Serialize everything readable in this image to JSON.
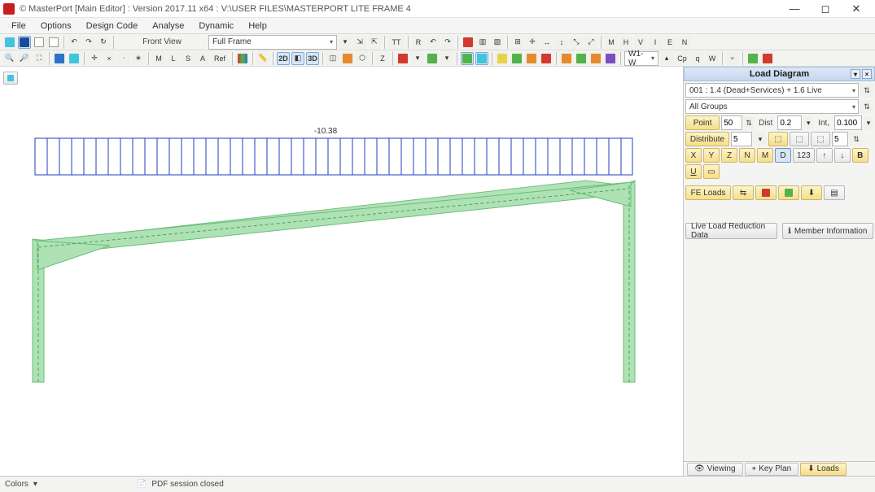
{
  "title": "© MasterPort [Main Editor] : Version 2017.11 x64 : V:\\USER FILES\\MASTERPORT LITE  FRAME 4",
  "menu": [
    "File",
    "Options",
    "Design Code",
    "Analyse",
    "Dynamic",
    "Help"
  ],
  "toolbar1": {
    "view_label": "Front View",
    "frame_select": "Full Frame",
    "letters": [
      "TT",
      "R",
      "S",
      "H",
      "V",
      "I",
      "E",
      "N"
    ],
    "middle_letters": [
      "M",
      "H",
      "V",
      "I",
      "E",
      "N"
    ],
    "r_label": "R"
  },
  "toolbar2": {
    "letters_group1": [
      "M",
      "L",
      "S",
      "A",
      "Ref"
    ],
    "z_label": "Z",
    "combo": "W1-W",
    "cp": "Cp",
    "q": "q",
    "w": "W"
  },
  "side": {
    "title": "Load Diagram",
    "case_select": "001 : 1.4 (Dead+Services) + 1.6 Live",
    "groups_select": "All Groups",
    "point_label": "Point",
    "point_val": "50",
    "dist_label": "Dist",
    "dist_val": "0.2",
    "int_label": "Int,",
    "int_val": "0.100",
    "distribute_label": "Distribute",
    "distribute_val": "5",
    "distribute_val2": "5",
    "axis_buttons": [
      "X",
      "Y",
      "Z",
      "N",
      "M",
      "D"
    ],
    "fe_label": "FE Loads",
    "live_btn": "Live Load Reduction Data",
    "member_btn": "Member Information"
  },
  "side_tabs": {
    "viewing": "Viewing",
    "keyplan": "Key Plan",
    "loads": "Loads"
  },
  "status": {
    "colors_label": "Colors",
    "pdf_label": "PDF session closed"
  },
  "canvas": {
    "load_value": "-10.38"
  }
}
